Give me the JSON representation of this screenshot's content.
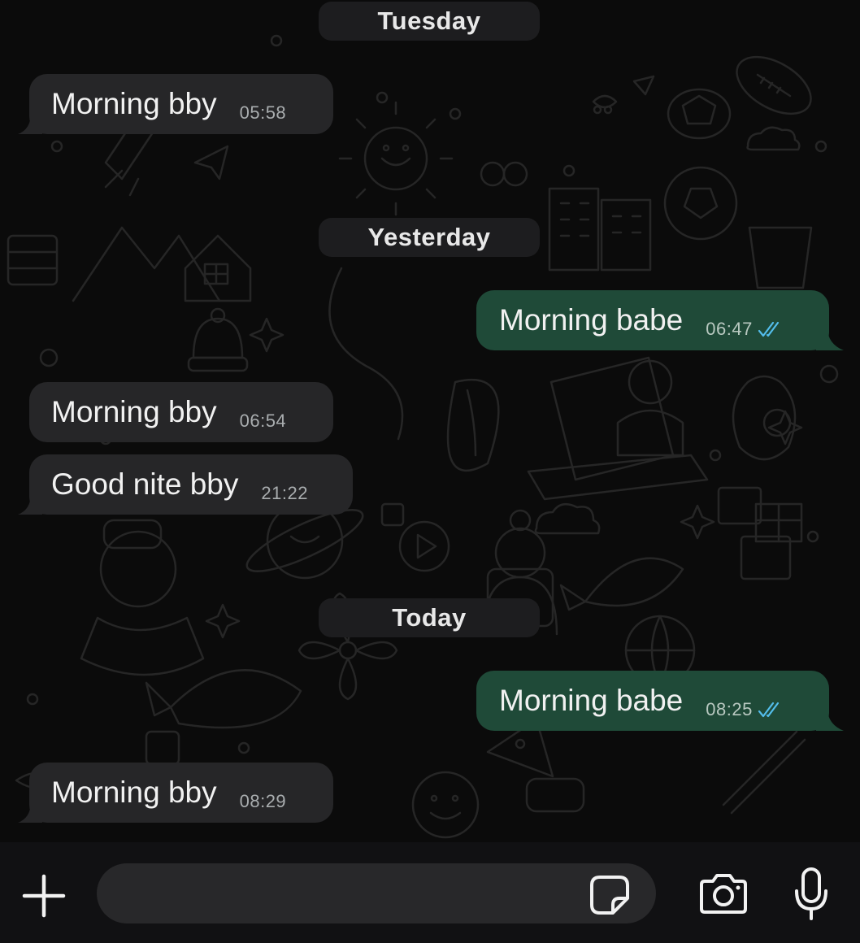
{
  "chat": {
    "date_separators": [
      "Tuesday",
      "Yesterday",
      "Today"
    ],
    "messages": [
      {
        "direction": "incoming",
        "text": "Morning bby",
        "time": "05:58"
      },
      {
        "direction": "outgoing",
        "text": "Morning babe",
        "time": "06:47",
        "status": "read"
      },
      {
        "direction": "incoming",
        "text": "Morning bby",
        "time": "06:54"
      },
      {
        "direction": "incoming",
        "text": "Good nite bby",
        "time": "21:22"
      },
      {
        "direction": "outgoing",
        "text": "Morning babe",
        "time": "08:25",
        "status": "read"
      },
      {
        "direction": "incoming",
        "text": "Morning bby",
        "time": "08:29"
      }
    ]
  },
  "composer": {
    "value": "",
    "placeholder": "",
    "icons": {
      "attach": "plus-icon",
      "sticker": "sticker-icon",
      "camera": "camera-icon",
      "voice": "microphone-icon"
    }
  },
  "colors": {
    "chat_background": "#0b0b0b",
    "incoming_bubble": "#262628",
    "outgoing_bubble": "#1f4a38",
    "read_ticks": "#53bdeb",
    "date_pill": "#1d1d1f",
    "input_bar": "#111113"
  }
}
